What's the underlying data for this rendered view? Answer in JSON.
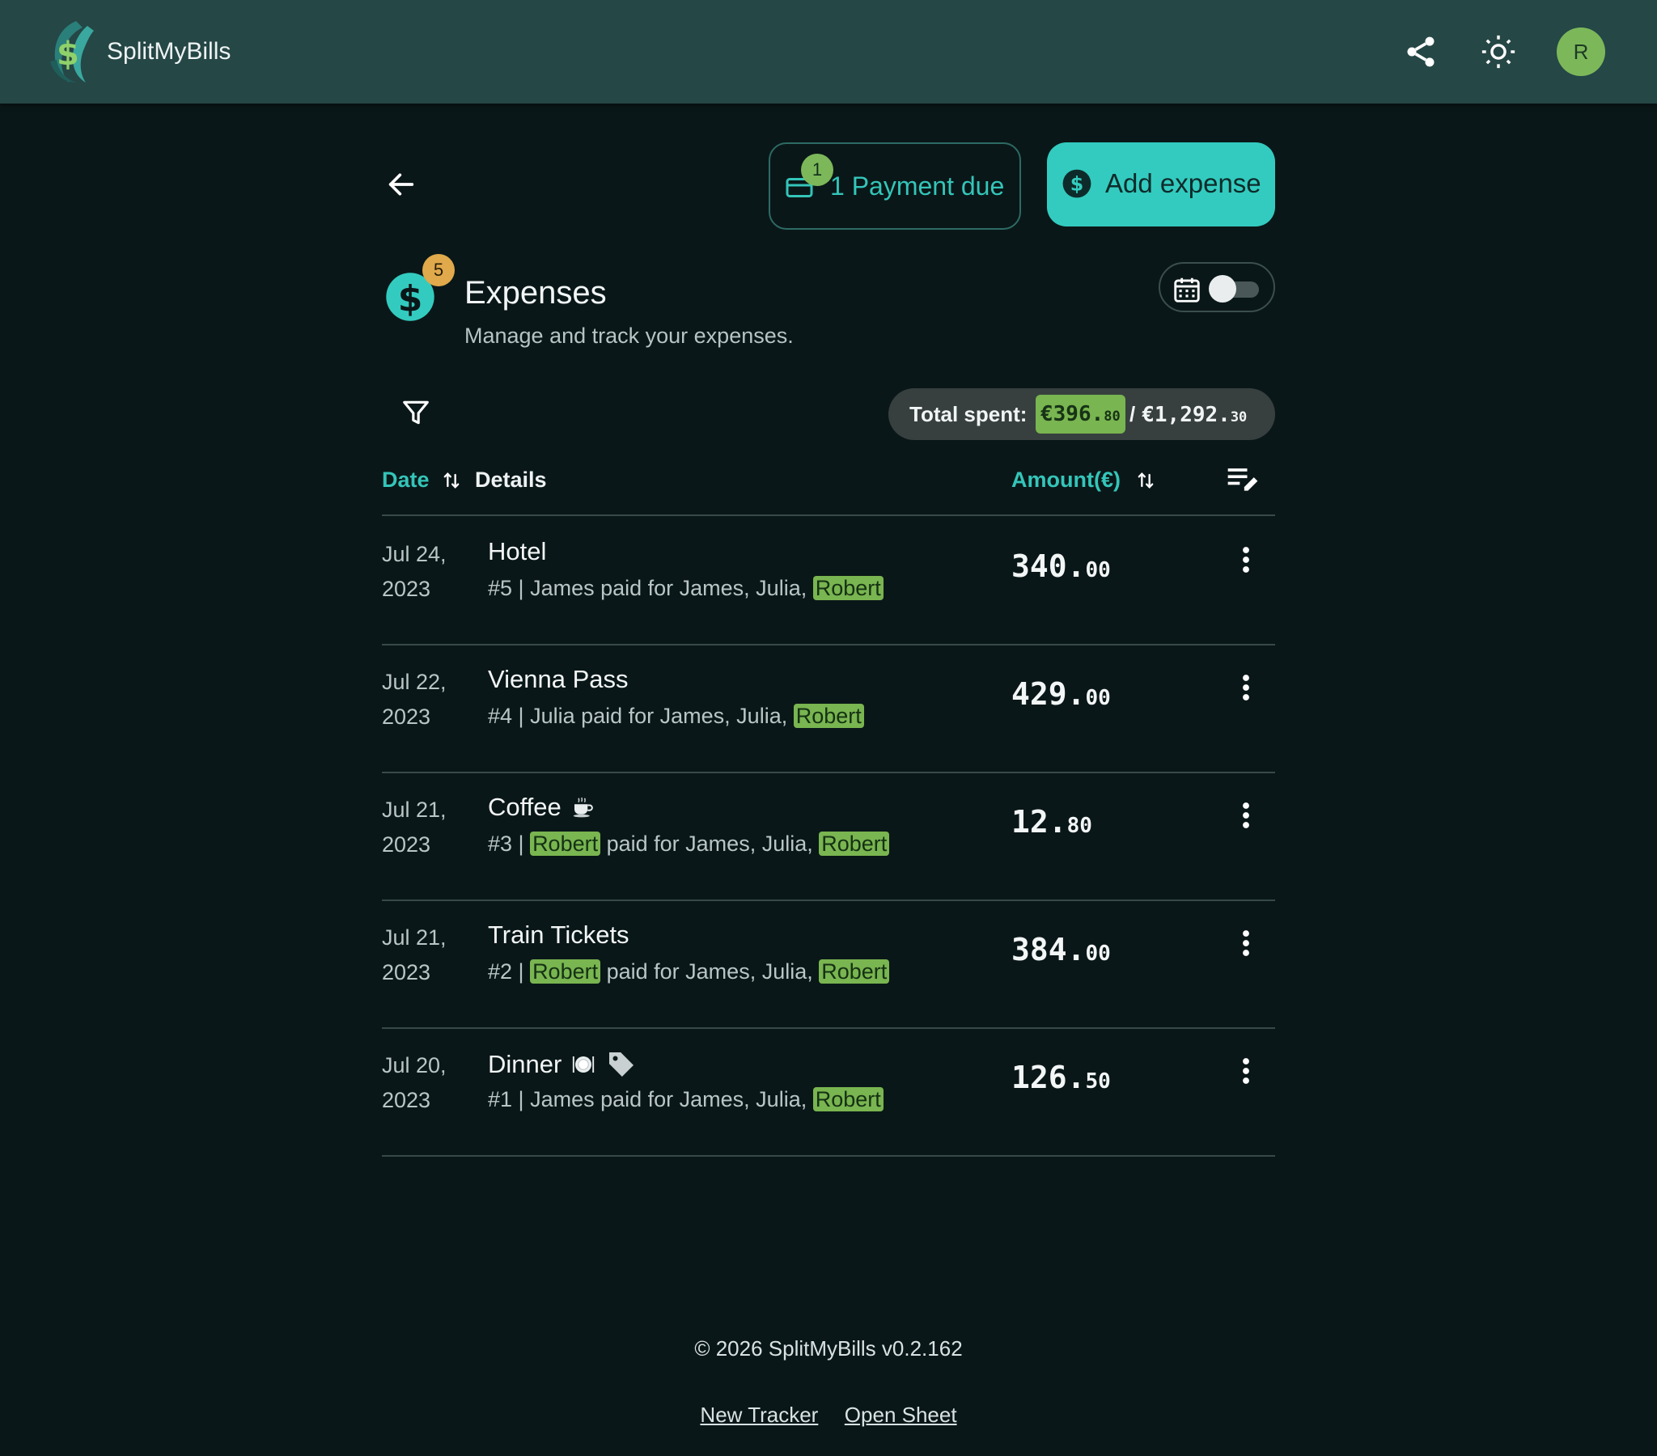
{
  "app": {
    "name": "SplitMyBills",
    "avatar_initial": "R"
  },
  "header_icons": [
    "share-icon",
    "sun-icon"
  ],
  "actions": {
    "payment_due_count": "1",
    "payment_due_label": "1 Payment due",
    "add_expense_label": "Add expense"
  },
  "expenses_section": {
    "count_badge": "5",
    "title": "Expenses",
    "subtitle": "Manage and track your expenses.",
    "calendar_view_enabled": false
  },
  "totals": {
    "label": "Total spent:",
    "spent_main": "€396.",
    "spent_cents": "80",
    "separator": "/",
    "total_main": "€1,292.",
    "total_cents": "30"
  },
  "table": {
    "col_date": "Date",
    "col_details": "Details",
    "col_amount": "Amount(€)"
  },
  "rows": [
    {
      "date": "Jul 24, 2023",
      "title": "Hotel",
      "icons": [],
      "ref": "#5 | ",
      "payer": "James",
      "payer_is_you": false,
      "for": " paid for James, Julia, ",
      "you": "Robert",
      "amount_main": "340.",
      "amount_cents": "00"
    },
    {
      "date": "Jul 22, 2023",
      "title": "Vienna Pass",
      "icons": [],
      "ref": "#4 | ",
      "payer": "Julia",
      "payer_is_you": false,
      "for": " paid for James, Julia, ",
      "you": "Robert",
      "amount_main": "429.",
      "amount_cents": "00"
    },
    {
      "date": "Jul 21, 2023",
      "title": "Coffee",
      "icons": [
        "coffee-icon"
      ],
      "ref": "#3 | ",
      "payer": "Robert",
      "payer_is_you": true,
      "for": " paid for James, Julia, ",
      "you": "Robert",
      "amount_main": "12.",
      "amount_cents": "80"
    },
    {
      "date": "Jul 21, 2023",
      "title": "Train Tickets",
      "icons": [],
      "ref": "#2 | ",
      "payer": "Robert",
      "payer_is_you": true,
      "for": " paid for James, Julia, ",
      "you": "Robert",
      "amount_main": "384.",
      "amount_cents": "00"
    },
    {
      "date": "Jul 20, 2023",
      "title": "Dinner",
      "icons": [
        "plate-icon",
        "tag-icon"
      ],
      "ref": "#1 | ",
      "payer": "James",
      "payer_is_you": false,
      "for": " paid for James, Julia, ",
      "you": "Robert",
      "amount_main": "126.",
      "amount_cents": "50"
    }
  ],
  "footer": {
    "copyright": "© 2026 SplitMyBills v0.2.162",
    "link_new_tracker": "New Tracker",
    "link_open_sheet": "Open Sheet"
  },
  "colors": {
    "background": "#0a1718",
    "header": "#254746",
    "accent": "#33cbbf",
    "highlight": "#79b550",
    "badge_orange": "#e0a94b"
  }
}
